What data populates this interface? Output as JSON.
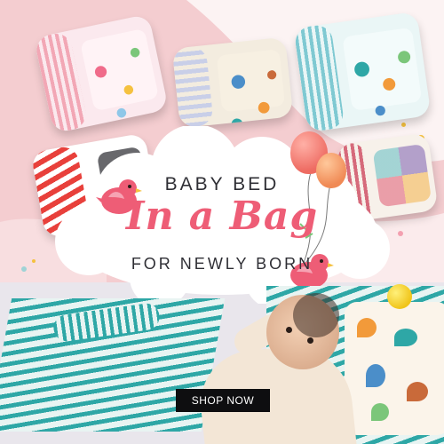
{
  "headline": {
    "top": "BABY BED",
    "script": "In a Bag",
    "bottom": "FOR NEWLY BORN"
  },
  "cta": {
    "label": "SHOP NOW"
  },
  "colors": {
    "background_pink": "#f4cdd0",
    "script_pink": "#ee5d76",
    "text_dark": "#2f2f35",
    "button_bg": "#0e0e10",
    "button_text": "#ffffff",
    "mat_teal": "#2ea7a6"
  },
  "icons": [
    "bird-icon",
    "balloon-icon"
  ]
}
